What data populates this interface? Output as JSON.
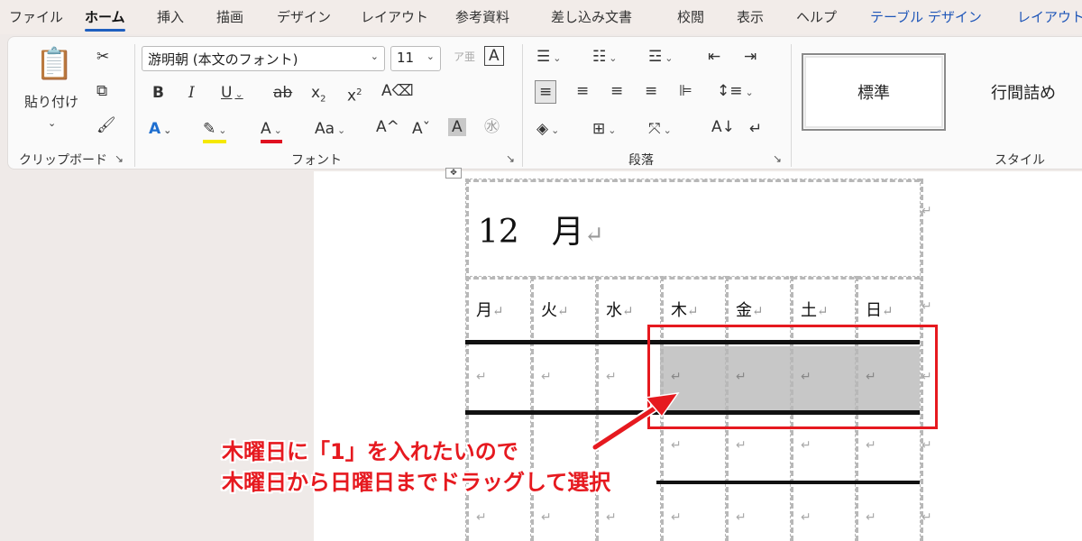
{
  "tabs": [
    {
      "label": "ファイル"
    },
    {
      "label": "ホーム"
    },
    {
      "label": "挿入"
    },
    {
      "label": "描画"
    },
    {
      "label": "デザイン"
    },
    {
      "label": "レイアウト"
    },
    {
      "label": "参考資料"
    },
    {
      "label": "差し込み文書"
    },
    {
      "label": "校閲"
    },
    {
      "label": "表示"
    },
    {
      "label": "ヘルプ"
    },
    {
      "label": "テーブル デザイン"
    },
    {
      "label": "レイアウト"
    }
  ],
  "ribbon": {
    "clipboard": {
      "paste_label": "貼り付け",
      "group_label": "クリップボード"
    },
    "font": {
      "font_name": "游明朝 (本文のフォント)",
      "font_size": "11",
      "group_label": "フォント"
    },
    "paragraph": {
      "group_label": "段落"
    },
    "styles": {
      "items": [
        "標準",
        "行間詰め"
      ],
      "group_label": "スタイル"
    }
  },
  "document": {
    "title": "12　月",
    "return_mark": "↵",
    "days": [
      "月",
      "火",
      "水",
      "木",
      "金",
      "土",
      "日"
    ]
  },
  "annotation": {
    "line1": "木曜日に「1」を入れたいので",
    "line2": "木曜日から日曜日までドラッグして選択",
    "color": "#e6191f"
  }
}
